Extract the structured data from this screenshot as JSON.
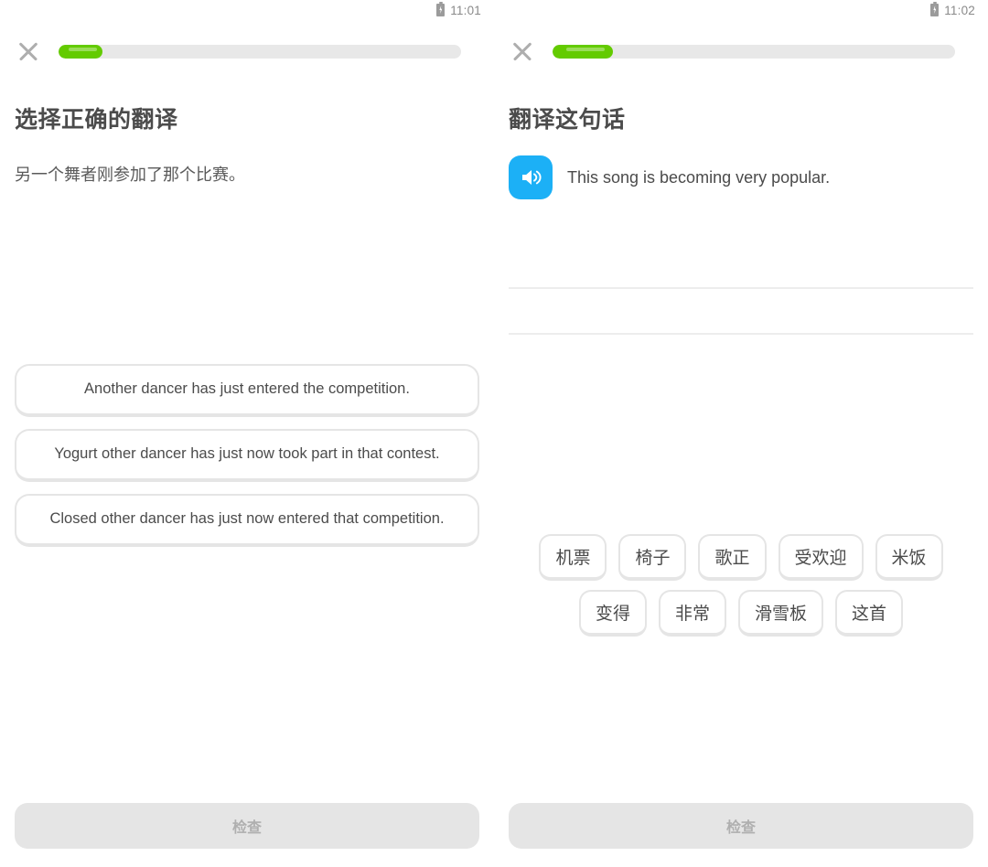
{
  "theme": {
    "progress_green": "#63CB00",
    "progress_track": "#E8E8E8",
    "speaker_blue": "#1CB0F6",
    "text_dark": "#4B4B4B",
    "border_gray": "#E5E5E5",
    "disabled_button_bg": "#E5E5E5",
    "disabled_button_text": "#AFAFAF"
  },
  "left_screen": {
    "status_bar": {
      "time": "11:01",
      "battery_icon": "battery-charging-icon"
    },
    "close_icon": "close-icon",
    "progress": {
      "percent": 11,
      "label": ""
    },
    "heading": "选择正确的翻译",
    "prompt": "另一个舞者刚参加了那个比赛。",
    "choices": [
      {
        "text": "Another dancer has just entered the competition."
      },
      {
        "text": "Yogurt other dancer has just now took part in that contest."
      },
      {
        "text": "Closed other dancer has just now entered that competition."
      }
    ],
    "check_button": "检查"
  },
  "right_screen": {
    "status_bar": {
      "time": "11:02",
      "battery_icon": "battery-charging-icon"
    },
    "close_icon": "close-icon",
    "progress": {
      "percent": 15,
      "label": ""
    },
    "heading": "翻译这句话",
    "speaker_icon": "speaker-icon",
    "sentence": "This song is becoming very popular.",
    "answer_lines": 2,
    "word_bank": {
      "row1": [
        "机票",
        "椅子",
        "歌正",
        "受欢迎",
        "米饭"
      ],
      "row2": [
        "变得",
        "非常",
        "滑雪板",
        "这首"
      ]
    },
    "check_button": "检查"
  }
}
